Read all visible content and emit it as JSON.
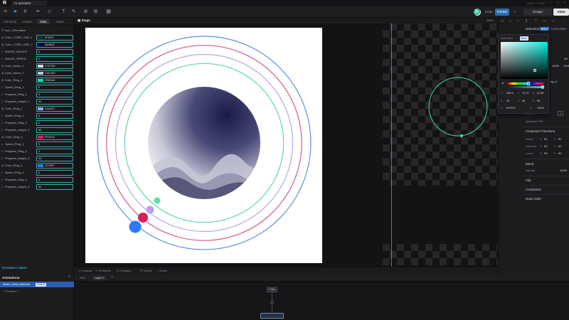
{
  "window": {
    "tab_title": "AI assistant",
    "right_text": "BASE • FREE",
    "controls": [
      "–",
      "□",
      "×"
    ]
  },
  "toolbar": {
    "modes": {
      "invite": "Invite",
      "publish": "Publish",
      "share": "⇪",
      "design": "Design",
      "animate": "Anim"
    }
  },
  "left_panel": {
    "tabs": [
      "Hierarchy",
      "Assets",
      "Data",
      "Agent"
    ],
    "active_tab": "Data",
    "variables": [
      {
        "name": "Icon_Orientation",
        "value": "",
        "type": "enum"
      },
      {
        "name": "Color_CORE_ONE_1",
        "value": "0F3037",
        "type": "color",
        "swatch": "#0f3037"
      },
      {
        "name": "Color_CORE_ONE_2",
        "value": "0B0B4E",
        "type": "color",
        "swatch": "#0b0b4e"
      },
      {
        "name": "WAVES_HEIGHT",
        "value": "0",
        "type": "number"
      },
      {
        "name": "WAVES_SPEED",
        "value": "0",
        "type": "number"
      },
      {
        "name": "Color_Wave_1",
        "value": "D7D7E0",
        "type": "color",
        "swatch": "#d7d7e0"
      },
      {
        "name": "Color_Wave_2",
        "value": "C0C0D0",
        "type": "color",
        "swatch": "#c0c0d0"
      },
      {
        "name": "Color_Ring_1",
        "value": "2BD5A8",
        "type": "color",
        "swatch": "#2bd5a8"
      },
      {
        "name": "Speed_Ring_1",
        "value": "5",
        "type": "number"
      },
      {
        "name": "Progress_Ring_1",
        "value": "0",
        "type": "number"
      },
      {
        "name": "Progress_weight_1",
        "value": "50",
        "type": "number"
      },
      {
        "name": "Color_Ring_2",
        "value": "A4A4E2",
        "type": "color",
        "swatch": "#a4a4e2"
      },
      {
        "name": "Speed_Ring_2",
        "value": "5",
        "type": "number"
      },
      {
        "name": "Progress_Ring_2",
        "value": "0",
        "type": "number"
      },
      {
        "name": "Progress_weight_2",
        "value": "50",
        "type": "number"
      },
      {
        "name": "Color_Ring_3",
        "value": "FE0A63",
        "type": "color",
        "swatch": "#d81e5b"
      },
      {
        "name": "Speed_Ring_3",
        "value": "5",
        "type": "number"
      },
      {
        "name": "Progress_Ring_3",
        "value": "0",
        "type": "number"
      },
      {
        "name": "Progress_weight_3",
        "value": "50",
        "type": "number"
      },
      {
        "name": "Color_Ring_4",
        "value": "2D78FF",
        "type": "color",
        "swatch": "#2d78ff"
      },
      {
        "name": "Speed_Ring_4",
        "value": "5",
        "type": "number"
      },
      {
        "name": "Progress_Ring_4",
        "value": "0",
        "type": "number"
      },
      {
        "name": "Progress_weight_4",
        "value": "50",
        "type": "number"
      }
    ],
    "instance_values": "Instance Values"
  },
  "animations": {
    "header": "Animations",
    "state_machine": "MAIN_Orbit_Machine",
    "badge": "Default",
    "timeline": "Timeline 1"
  },
  "stage": {
    "label": "Stage",
    "zoom": "345%",
    "rings": [
      {
        "color": "#5b8fe0",
        "radius_frac": 0.94
      },
      {
        "color": "#d55a8a",
        "radius_frac": 0.86
      },
      {
        "color": "#b5a8e0",
        "radius_frac": 0.78
      },
      {
        "color": "#5fd8a8",
        "radius_frac": 0.7
      }
    ],
    "dots": [
      {
        "color": "#5fe0a0",
        "size": "small"
      },
      {
        "color": "#b8a0f0",
        "size": "medium"
      },
      {
        "color": "#d81e5b",
        "size": "large"
      },
      {
        "color": "#2d78ff",
        "size": "xlarge"
      }
    ],
    "side_circle_color": "#3dd598"
  },
  "bottom_tabs": [
    "Console",
    "Problems",
    "Changes",
    "Testing",
    "Audio"
  ],
  "graph": {
    "zoom": "99%",
    "layer_tab": "Layer 1",
    "entry_node": "Entry"
  },
  "right_panel": {
    "tabs": [
      "Data Bind",
      "Bind",
      "Unbindable"
    ],
    "fields": {
      "opacity_right": "-90",
      "percent": "100%",
      "rot_val": "2405",
      "bind_tail": "ng_4",
      "speed_label": "Speed",
      "speed_val": "1",
      "quantize": "Quantize FPS"
    },
    "composed_transform": "Composed Transform",
    "transform_rows": [
      {
        "label": "World",
        "a": "X",
        "av": "90",
        "b": "Y",
        "bv": "90"
      },
      {
        "label": "Artboard",
        "a": "X",
        "av": "90",
        "b": "Y",
        "bv": "90"
      },
      {
        "label": "Local",
        "a": "X",
        "av": "90",
        "b": "Y",
        "bv": "90"
      }
    ],
    "blend": "Blend",
    "blend_mode": "Normal",
    "blend_pct": "100%",
    "clip": "Clip",
    "constraints": "Constraints",
    "draw_order": "Draw Order"
  },
  "picker": {
    "tabs": [
      "Data Bind",
      "Bind"
    ],
    "h": "180.6",
    "s": "72.75",
    "b": "21.65",
    "r": "15",
    "g": "48",
    "b2": "55",
    "hex": "0F3037",
    "a": "100%"
  }
}
